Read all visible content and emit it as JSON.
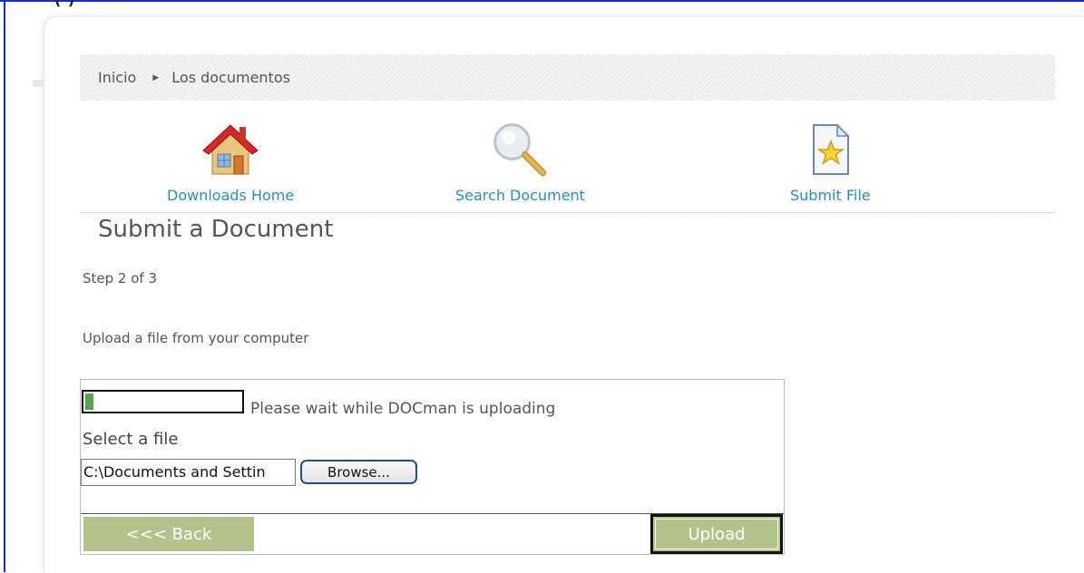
{
  "top_strip": "(   )",
  "breadcrumb": {
    "home": "Inicio",
    "current": "Los documentos"
  },
  "nav": {
    "downloads_home": "Downloads Home",
    "search_document": "Search Document",
    "submit_file": "Submit File"
  },
  "page": {
    "title": "Submit a Document",
    "step": "Step 2 of 3",
    "instruction": "Upload a file from your computer"
  },
  "form": {
    "progress_value": 0.06,
    "wait_message": "Please wait while DOCman is uploading",
    "select_label": "Select a file",
    "file_path": "C:\\Documents and Settin",
    "browse_label": "Browse...",
    "back_label": "<<< Back",
    "upload_label": "Upload"
  },
  "colors": {
    "accent_link": "#2a8fb0",
    "button_bg": "#b3c38c",
    "progress_fill": "#54a354",
    "border_blue": "#1a2bd4"
  }
}
